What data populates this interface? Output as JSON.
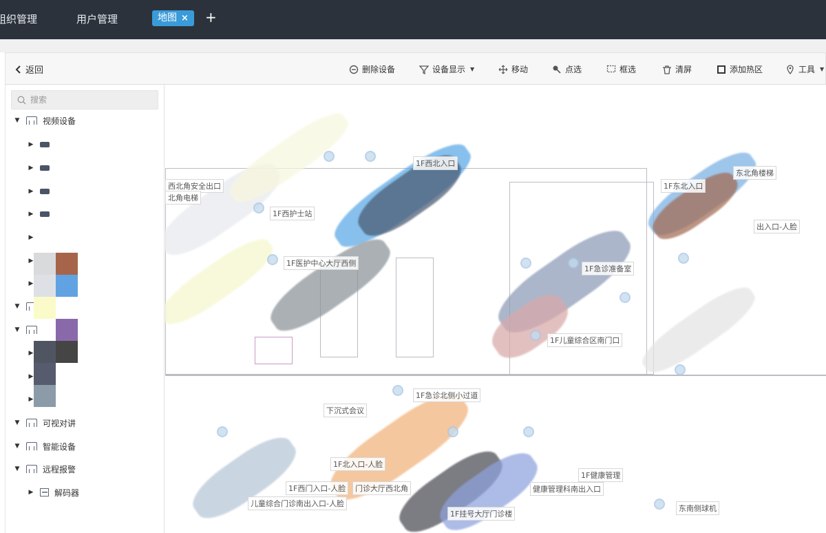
{
  "topbar": {
    "nav_items": [
      "组织管理",
      "用户管理"
    ],
    "active_tab": "地图",
    "close_symbol": "×",
    "add_symbol": "+"
  },
  "toolbar": {
    "back_label": "返回",
    "tools": [
      {
        "label": "删除设备",
        "icon": "delete-device-icon"
      },
      {
        "label": "设备显示",
        "icon": "filter-icon",
        "dropdown": true
      },
      {
        "label": "移动",
        "icon": "move-icon"
      },
      {
        "label": "点选",
        "icon": "point-select-icon"
      },
      {
        "label": "框选",
        "icon": "box-select-icon"
      },
      {
        "label": "清屏",
        "icon": "clear-screen-icon"
      },
      {
        "label": "添加热区",
        "icon": "add-hotzone-icon"
      },
      {
        "label": "工具",
        "icon": "location-pin-icon",
        "dropdown": true
      }
    ]
  },
  "sidebar": {
    "search_placeholder": "搜索",
    "tree": [
      {
        "label": "视频设备"
      },
      {
        "label": "可视对讲"
      },
      {
        "label": "智能设备"
      },
      {
        "label": "远程报警"
      },
      {
        "label": "解码器"
      }
    ]
  },
  "map": {
    "labels": [
      "1F西门入口-人脸",
      "1F北入口-人脸",
      "1F挂号大厅门诊楼",
      "儿童综合门诊南出入口-人脸",
      "门诊大厅西北角",
      "下沉式会议",
      "东南侧球机",
      "1F健康管理",
      "健康管理科南出入口",
      "出入口-人脸",
      "1F急诊准备室",
      "1F儿童综合区南门口",
      "1F西护士站",
      "西北角安全出口",
      "北角电梯",
      "1F医护中心大厅西侧",
      "1F急诊北侧小过道",
      "1F西北入口",
      "1F东北入口",
      "东北角楼梯"
    ]
  }
}
